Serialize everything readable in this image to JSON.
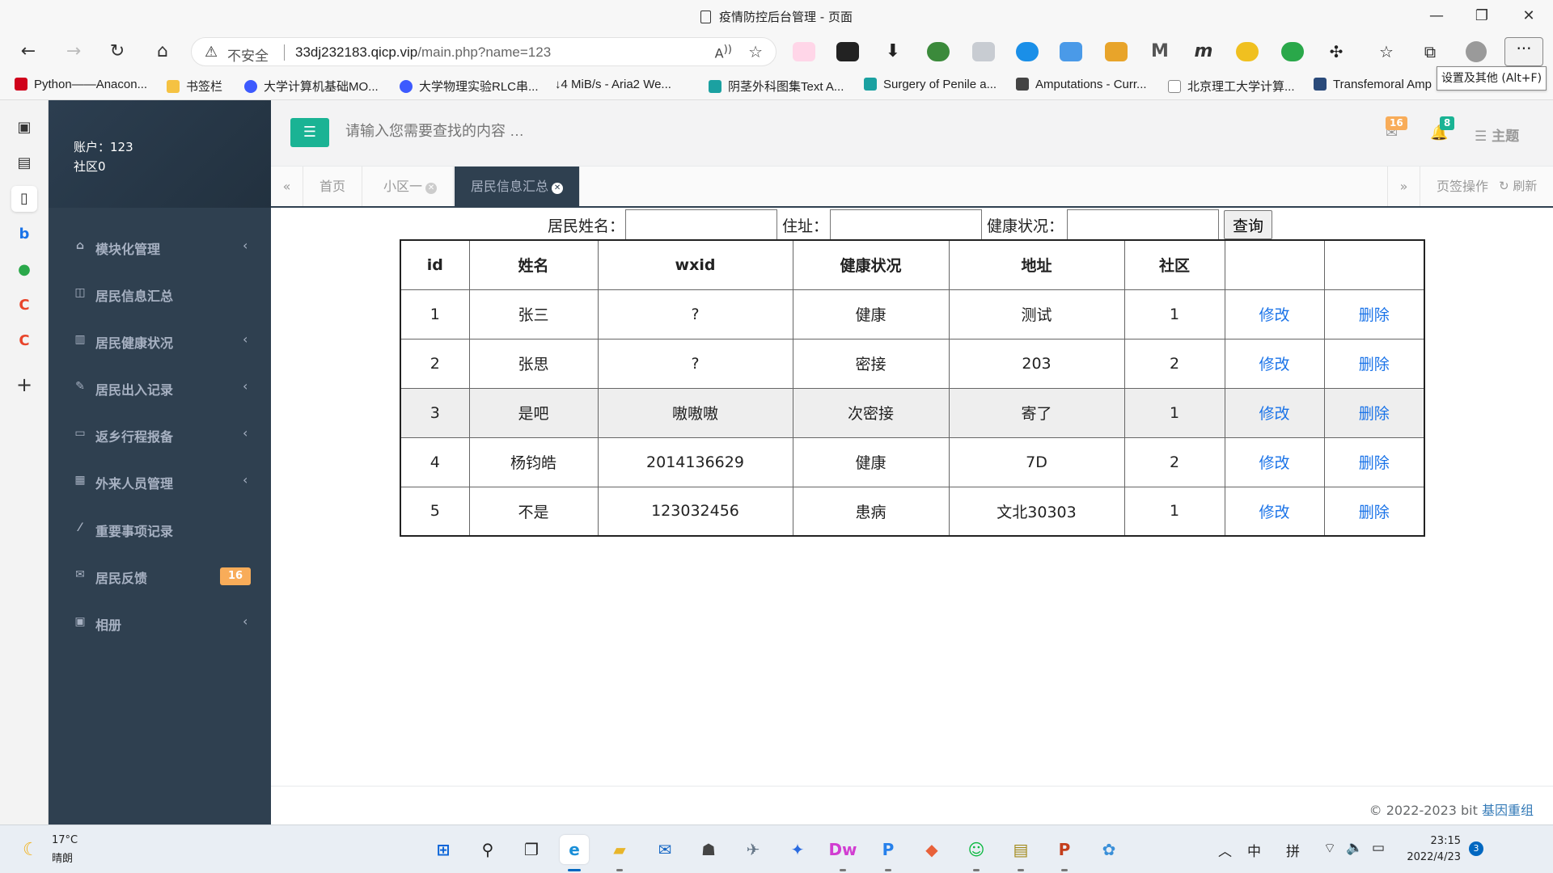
{
  "window": {
    "title": "疫情防控后台管理 - 页面",
    "minimize": "—",
    "restore": "❐",
    "close": "✕"
  },
  "browser": {
    "back": "←",
    "forward": "→",
    "reload": "↻",
    "home": "⌂",
    "security_label": "不安全",
    "url_host": "33dj232183.qicp.vip",
    "url_path": "/main.php?name=123",
    "more": "···",
    "tooltip": "设置及其他 (Alt+F)"
  },
  "bookmarks": [
    {
      "label": "Python——Anacon...",
      "color": "#d0021b"
    },
    {
      "label": "书签栏",
      "color": "#f5c242"
    },
    {
      "label": "大学计算机基础MO...",
      "color": "#3d5afe"
    },
    {
      "label": "大学物理实验RLC串...",
      "color": "#3d5afe"
    },
    {
      "label": "↓4 MiB/s - Aria2 We...",
      "color": "#222222"
    },
    {
      "label": "阴茎外科图集Text A...",
      "color": "#1ba1a1"
    },
    {
      "label": "Surgery of Penile a...",
      "color": "#1ba1a1"
    },
    {
      "label": "Amputations - Curr...",
      "color": "#444444"
    },
    {
      "label": "北京理工大学计算...",
      "color": "#888888"
    },
    {
      "label": "Transfemoral Amp",
      "color": "#2a4a7a"
    }
  ],
  "app": {
    "account_label": "账户：123",
    "community_label": "社区0",
    "search_placeholder": "请输入您需要查找的内容 …",
    "mail_count": "16",
    "bell_count": "8",
    "theme_label": "主题",
    "menu": [
      {
        "label": "模块化管理",
        "icon": "home-icon",
        "glyph": "⌂",
        "chevron": true
      },
      {
        "label": "居民信息汇总",
        "icon": "columns-icon",
        "glyph": "◫",
        "chevron": false
      },
      {
        "label": "居民健康状况",
        "icon": "bar-chart-icon",
        "glyph": "▥",
        "chevron": true
      },
      {
        "label": "居民出入记录",
        "icon": "edit-icon",
        "glyph": "✎",
        "chevron": true
      },
      {
        "label": "返乡行程报备",
        "icon": "desktop-icon",
        "glyph": "▭",
        "chevron": true
      },
      {
        "label": "外来人员管理",
        "icon": "table-icon",
        "glyph": "▦",
        "chevron": true
      },
      {
        "label": "重要事项记录",
        "icon": "magic-icon",
        "glyph": "⁄",
        "chevron": false
      },
      {
        "label": "居民反馈",
        "icon": "envelope-icon",
        "glyph": "✉",
        "chevron": false,
        "badge": "16"
      },
      {
        "label": "相册",
        "icon": "picture-icon",
        "glyph": "▣",
        "chevron": true
      }
    ],
    "tabs": [
      {
        "label": "首页",
        "closable": false,
        "active": false
      },
      {
        "label": "小区一",
        "closable": true,
        "active": false
      },
      {
        "label": "居民信息汇总",
        "closable": true,
        "active": true
      }
    ],
    "tab_ops_label": "页签操作",
    "refresh_label": "刷新",
    "footer_text": "© 2022-2023 bit ",
    "footer_link": "基因重组"
  },
  "form": {
    "name_label": "居民姓名：",
    "address_label": "住址：",
    "health_label": "健康状况：",
    "query_button": "查询"
  },
  "table": {
    "headers": [
      "id",
      "姓名",
      "wxid",
      "健康状况",
      "地址",
      "社区",
      "",
      ""
    ],
    "rows": [
      {
        "id": "1",
        "name": "张三",
        "wxid": "?",
        "health": "健康",
        "address": "测试",
        "community": "1",
        "edit": "修改",
        "delete": "删除"
      },
      {
        "id": "2",
        "name": "张思",
        "wxid": "?",
        "health": "密接",
        "address": "203",
        "community": "2",
        "edit": "修改",
        "delete": "删除"
      },
      {
        "id": "3",
        "name": "是吧",
        "wxid": "嗷嗷嗷",
        "health": "次密接",
        "address": "寄了",
        "community": "1",
        "edit": "修改",
        "delete": "删除"
      },
      {
        "id": "4",
        "name": "杨钧皓",
        "wxid": "2014136629",
        "health": "健康",
        "address": "7D",
        "community": "2",
        "edit": "修改",
        "delete": "删除"
      },
      {
        "id": "5",
        "name": "不是",
        "wxid": "123032456",
        "health": "患病",
        "address": "文北30303",
        "community": "1",
        "edit": "修改",
        "delete": "删除"
      }
    ],
    "highlighted_row": 2
  },
  "taskbar": {
    "temperature": "17°C",
    "condition": "晴朗",
    "ime_lang": "中",
    "ime_mode": "拼",
    "time": "23:15",
    "date": "2022/4/23",
    "notifications": "3",
    "apps": [
      {
        "name": "start-button",
        "glyph": "⊞",
        "color": "#0a64d8"
      },
      {
        "name": "search-button",
        "glyph": "⚲",
        "color": "#222222"
      },
      {
        "name": "task-view-button",
        "glyph": "❐",
        "color": "#222222"
      },
      {
        "name": "edge-app",
        "glyph": "e",
        "color": "#1a8fd8"
      },
      {
        "name": "file-explorer-app",
        "glyph": "▰",
        "color": "#e8b52a"
      },
      {
        "name": "mail-app",
        "glyph": "✉",
        "color": "#1667c4"
      },
      {
        "name": "alien-app",
        "glyph": "☗",
        "color": "#444444"
      },
      {
        "name": "plane-app",
        "glyph": "✈",
        "color": "#667788"
      },
      {
        "name": "lark-app",
        "glyph": "✦",
        "color": "#2a6be0"
      },
      {
        "name": "dreamweaver-app",
        "glyph": "Dw",
        "color": "#d13dd1"
      },
      {
        "name": "p-app",
        "glyph": "P",
        "color": "#2680eb"
      },
      {
        "name": "cube-app",
        "glyph": "◆",
        "color": "#e8613a"
      },
      {
        "name": "wechat-app",
        "glyph": "☺",
        "color": "#09b83e"
      },
      {
        "name": "folder-app",
        "glyph": "▤",
        "color": "#a28a1a"
      },
      {
        "name": "powerpoint-app",
        "glyph": "P",
        "color": "#c43e1c"
      },
      {
        "name": "paint-app",
        "glyph": "✿",
        "color": "#3a8fd8"
      }
    ]
  }
}
